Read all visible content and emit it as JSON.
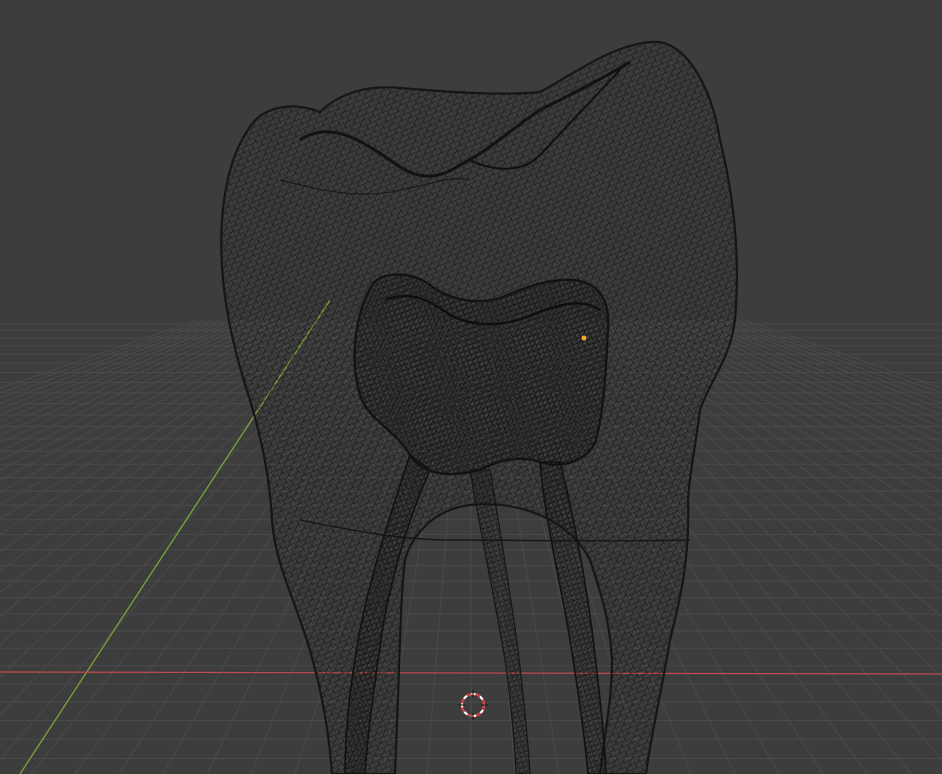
{
  "viewport": {
    "kind": "3d-viewport",
    "shading": "wireframe",
    "object": "tooth",
    "colors": {
      "background": "#3d3d3d",
      "grid_line": "#4a4a4a",
      "grid_line_dark": "#363636",
      "x_axis": "#c34b4f",
      "y_axis": "#7aa43c",
      "wire": "#141414",
      "origin": "#f5a42b",
      "cursor_red": "#d6363c",
      "cursor_white": "#ffffff"
    },
    "icons": {
      "origin": "object-origin-icon",
      "cursor": "3d-cursor-icon"
    }
  }
}
